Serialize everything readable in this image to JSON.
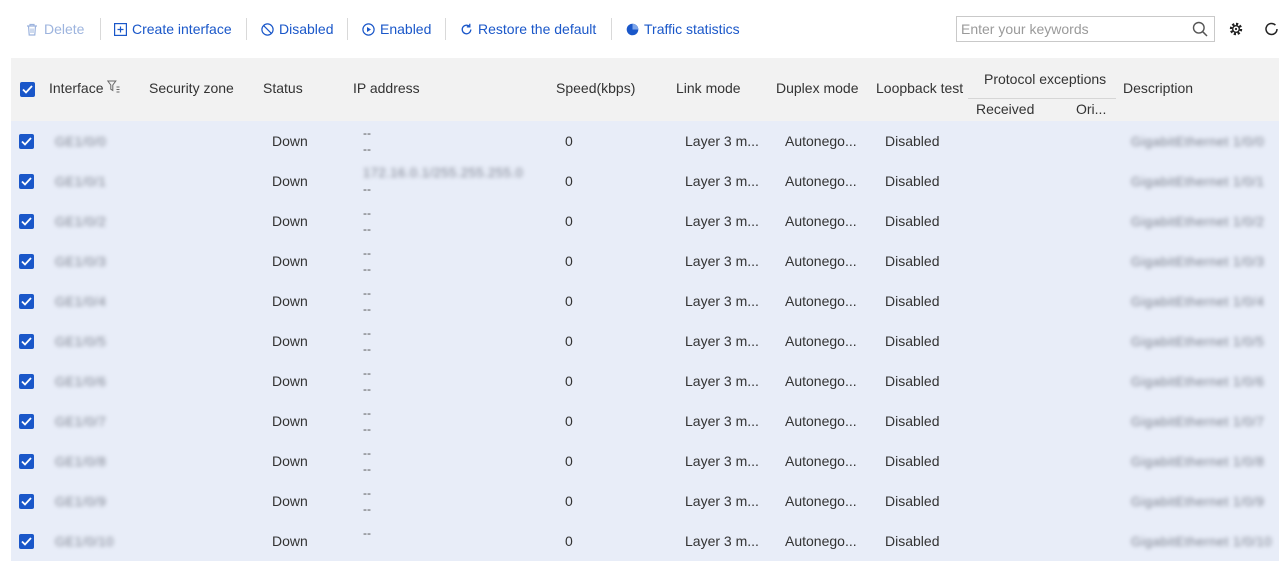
{
  "toolbar": {
    "delete": "Delete",
    "create": "Create interface",
    "disabled": "Disabled",
    "enabled": "Enabled",
    "restore": "Restore the default",
    "traffic": "Traffic statistics",
    "search_placeholder": "Enter your keywords"
  },
  "colors": {
    "accent": "#1a57c9",
    "row_bg": "#e8edf8",
    "header_bg": "#f2f2f2"
  },
  "table": {
    "columns": {
      "interface": "Interface",
      "security_zone": "Security zone",
      "status": "Status",
      "ip_address": "IP address",
      "speed": "Speed(kbps)",
      "link_mode": "Link mode",
      "duplex_mode": "Duplex mode",
      "loopback": "Loopback test",
      "protocol": "Protocol exceptions",
      "received": "Received",
      "originated": "Ori...",
      "description": "Description"
    },
    "rows": [
      {
        "name": "GE1/0/0",
        "status": "Down",
        "ip1": "--",
        "ip2": "--",
        "speed": "0",
        "link": "Layer 3 m...",
        "duplex": "Autonego...",
        "loop": "Disabled",
        "desc": "GigabitEthernet 1/0/0"
      },
      {
        "name": "GE1/0/1",
        "status": "Down",
        "ip1": "172.16.0.1/255.255.255.0",
        "ip2": "--",
        "speed": "0",
        "link": "Layer 3 m...",
        "duplex": "Autonego...",
        "loop": "Disabled",
        "desc": "GigabitEthernet 1/0/1"
      },
      {
        "name": "GE1/0/2",
        "status": "Down",
        "ip1": "--",
        "ip2": "--",
        "speed": "0",
        "link": "Layer 3 m...",
        "duplex": "Autonego...",
        "loop": "Disabled",
        "desc": "GigabitEthernet 1/0/2"
      },
      {
        "name": "GE1/0/3",
        "status": "Down",
        "ip1": "--",
        "ip2": "--",
        "speed": "0",
        "link": "Layer 3 m...",
        "duplex": "Autonego...",
        "loop": "Disabled",
        "desc": "GigabitEthernet 1/0/3"
      },
      {
        "name": "GE1/0/4",
        "status": "Down",
        "ip1": "--",
        "ip2": "--",
        "speed": "0",
        "link": "Layer 3 m...",
        "duplex": "Autonego...",
        "loop": "Disabled",
        "desc": "GigabitEthernet 1/0/4"
      },
      {
        "name": "GE1/0/5",
        "status": "Down",
        "ip1": "--",
        "ip2": "--",
        "speed": "0",
        "link": "Layer 3 m...",
        "duplex": "Autonego...",
        "loop": "Disabled",
        "desc": "GigabitEthernet 1/0/5"
      },
      {
        "name": "GE1/0/6",
        "status": "Down",
        "ip1": "--",
        "ip2": "--",
        "speed": "0",
        "link": "Layer 3 m...",
        "duplex": "Autonego...",
        "loop": "Disabled",
        "desc": "GigabitEthernet 1/0/6"
      },
      {
        "name": "GE1/0/7",
        "status": "Down",
        "ip1": "--",
        "ip2": "--",
        "speed": "0",
        "link": "Layer 3 m...",
        "duplex": "Autonego...",
        "loop": "Disabled",
        "desc": "GigabitEthernet 1/0/7"
      },
      {
        "name": "GE1/0/8",
        "status": "Down",
        "ip1": "--",
        "ip2": "--",
        "speed": "0",
        "link": "Layer 3 m...",
        "duplex": "Autonego...",
        "loop": "Disabled",
        "desc": "GigabitEthernet 1/0/8"
      },
      {
        "name": "GE1/0/9",
        "status": "Down",
        "ip1": "--",
        "ip2": "--",
        "speed": "0",
        "link": "Layer 3 m...",
        "duplex": "Autonego...",
        "loop": "Disabled",
        "desc": "GigabitEthernet 1/0/9"
      },
      {
        "name": "GE1/0/10",
        "status": "Down",
        "ip1": "--",
        "ip2": "",
        "speed": "0",
        "link": "Layer 3 m...",
        "duplex": "Autonego...",
        "loop": "Disabled",
        "desc": "GigabitEthernet 1/0/10"
      }
    ]
  }
}
